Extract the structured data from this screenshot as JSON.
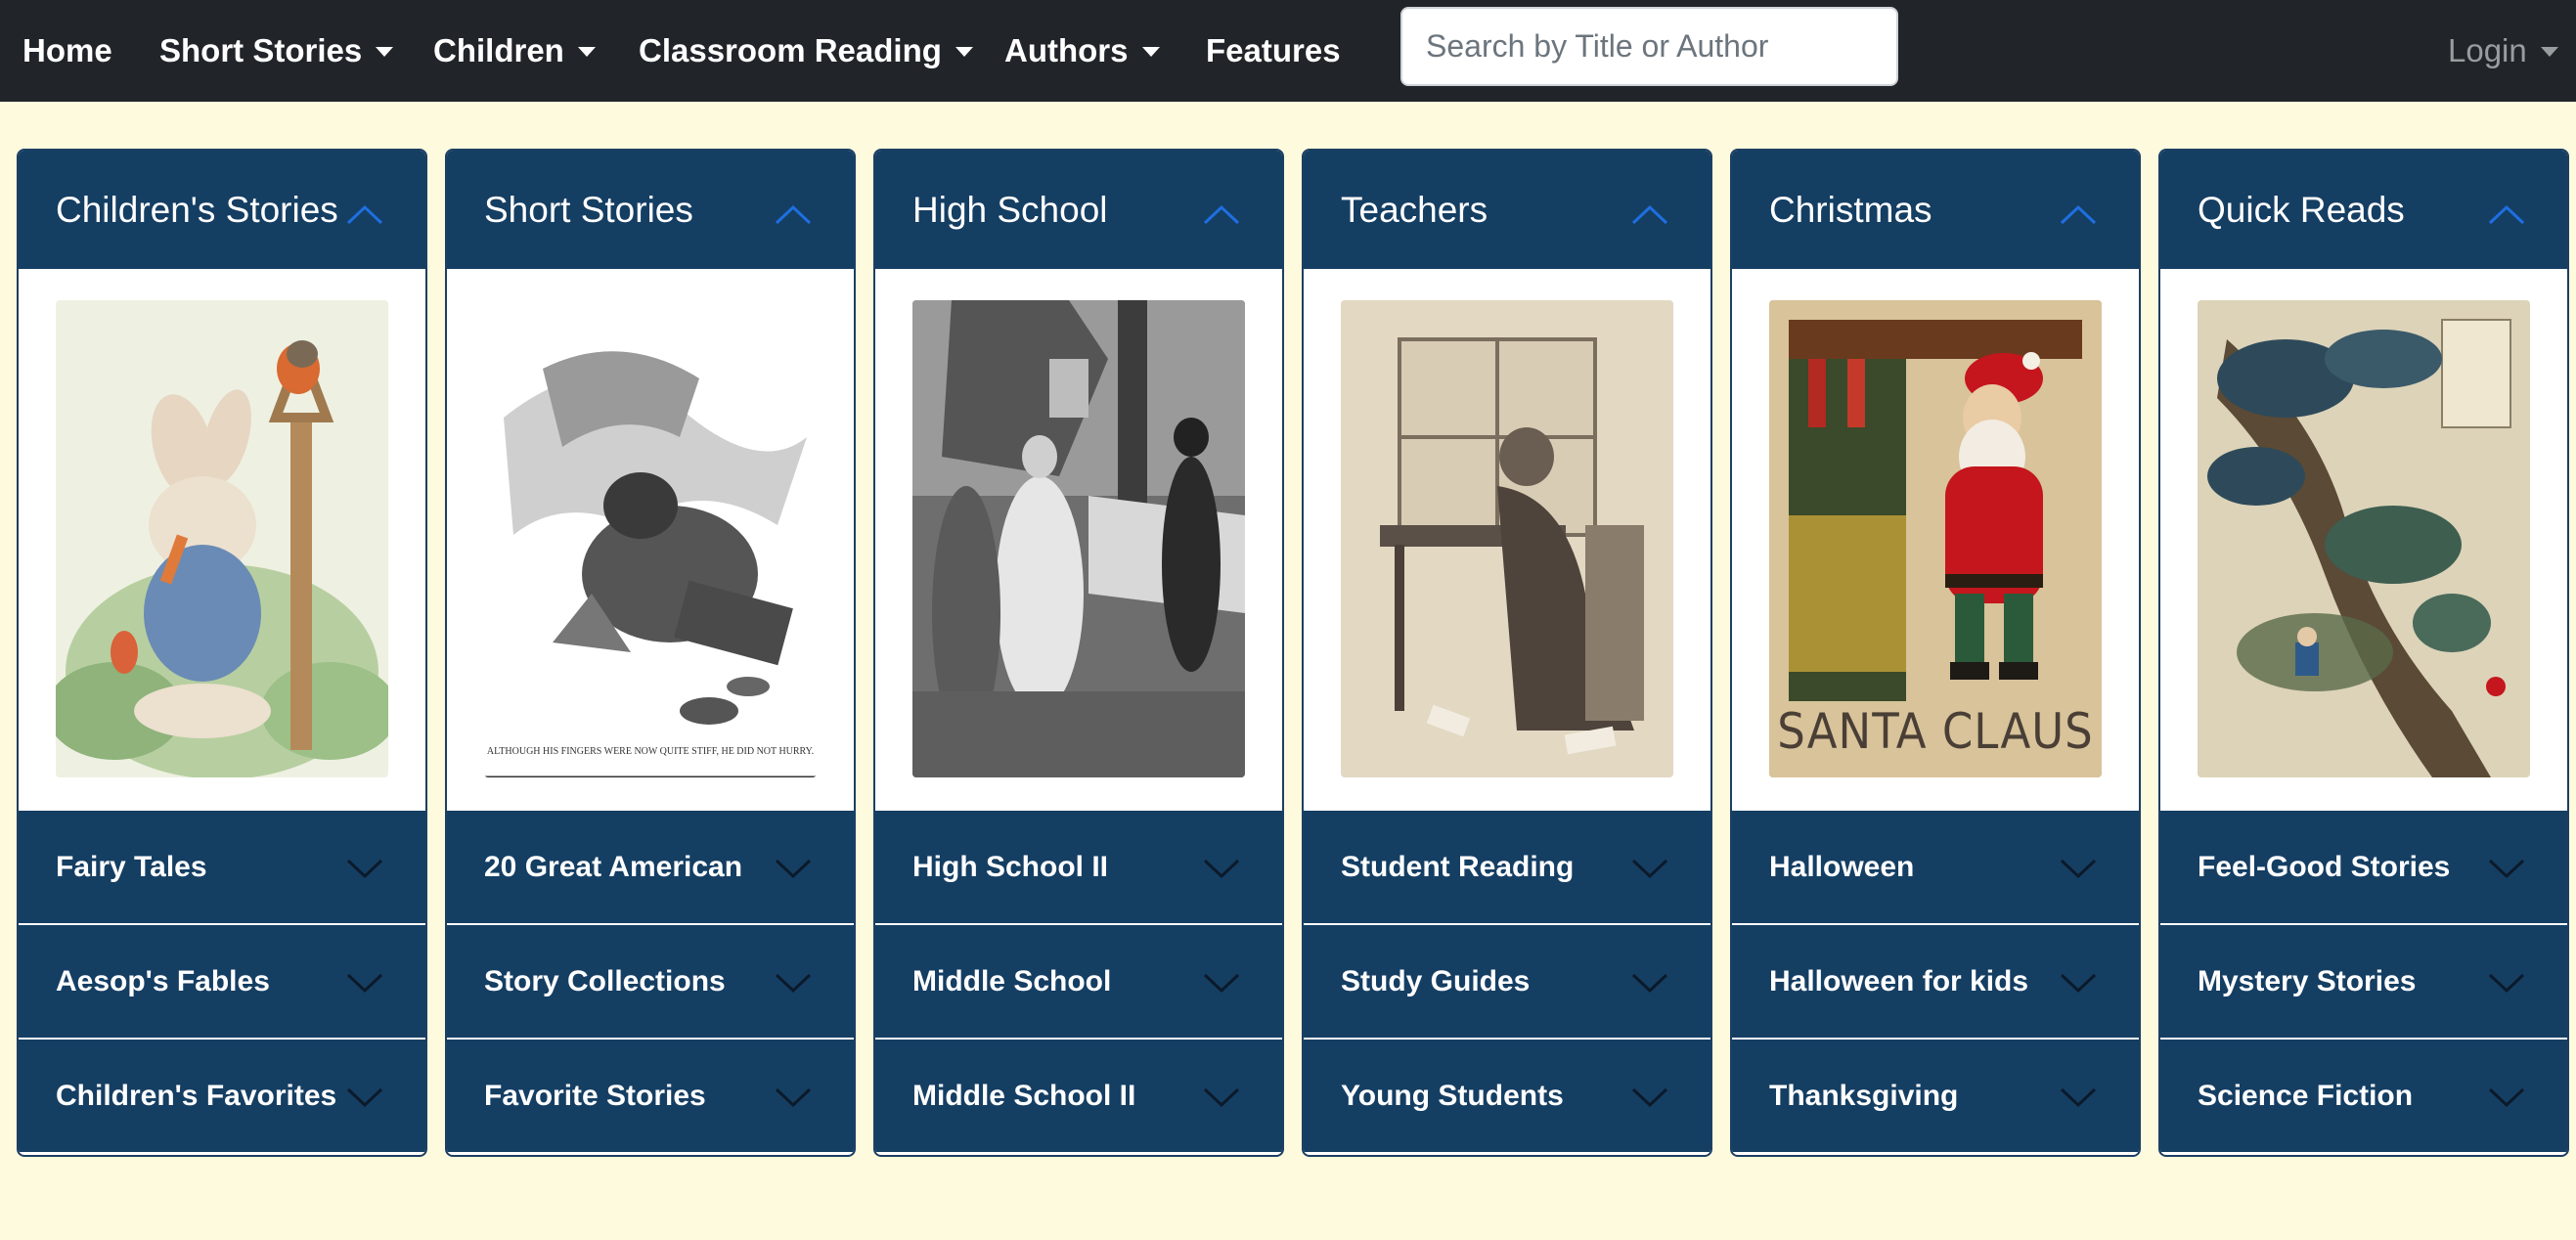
{
  "nav": {
    "home": "Home",
    "short_stories": "Short Stories",
    "children": "Children",
    "classroom_reading": "Classroom Reading",
    "authors": "Authors",
    "features": "Features",
    "search_placeholder": "Search by Title or Author",
    "login": "Login"
  },
  "cards": [
    {
      "title": "Children's Stories",
      "image_icon": "peter-rabbit-illustration",
      "items": [
        "Fairy Tales",
        "Aesop's Fables",
        "Children's Favorites"
      ]
    },
    {
      "title": "Short Stories",
      "image_icon": "man-kneeling-by-fire-illustration",
      "image_caption": "ALTHOUGH HIS FINGERS WERE NOW QUITE STIFF, HE DID NOT HURRY.",
      "items": [
        "20 Great American",
        "Story Collections",
        "Favorite Stories"
      ]
    },
    {
      "title": "High School",
      "image_icon": "figures-by-picket-fence-photo",
      "items": [
        "High School II",
        "Middle School",
        "Middle School II"
      ]
    },
    {
      "title": "Teachers",
      "image_icon": "woman-writing-at-desk-engraving",
      "items": [
        "Student Reading",
        "Study Guides",
        "Young Students"
      ]
    },
    {
      "title": "Christmas",
      "image_icon": "santa-claus-poster",
      "image_caption": "SANTA CLAUS",
      "items": [
        "Halloween",
        "Halloween for kids",
        "Thanksgiving"
      ]
    },
    {
      "title": "Quick Reads",
      "image_icon": "japanese-woodblock-tree-print",
      "items": [
        "Feel-Good Stories",
        "Mystery Stories",
        "Science Fiction"
      ]
    }
  ],
  "colors": {
    "navbar": "#212529",
    "page_bg": "#fdfadd",
    "card_header": "#153e63",
    "chevron_up": "#1e6fe0",
    "chevron_down": "#0b1a2a"
  }
}
